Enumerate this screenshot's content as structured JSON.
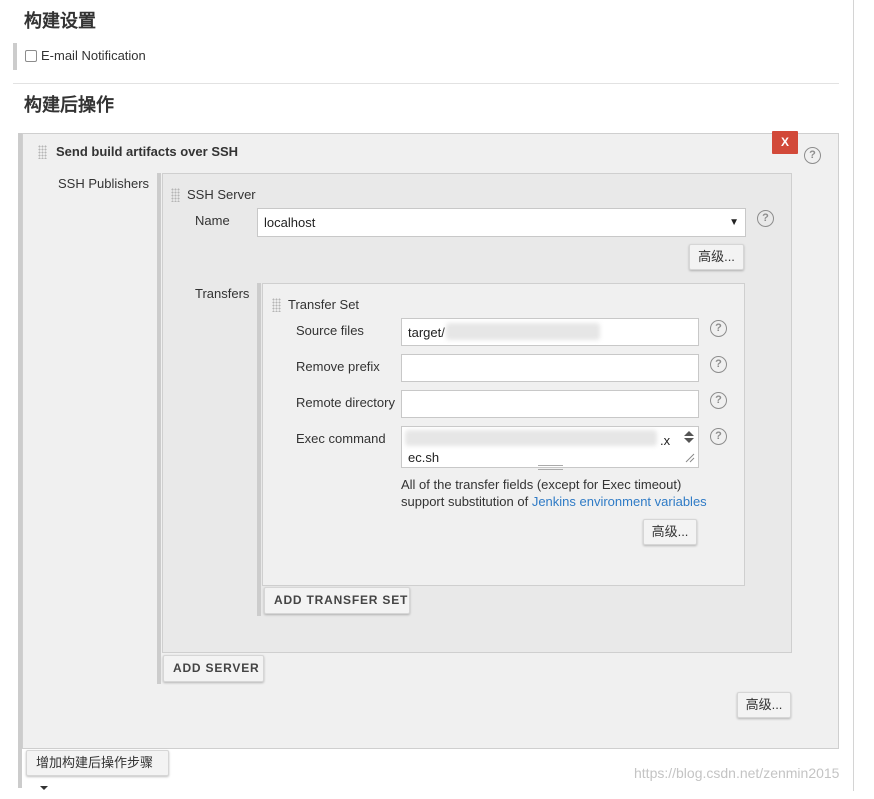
{
  "build_settings": {
    "title": "构建设置",
    "email_notification_label": "E-mail Notification",
    "email_notification_checked": false
  },
  "post_build": {
    "title": "构建后操作",
    "publisher": {
      "title": "Send build artifacts over SSH",
      "delete_label": "X",
      "ssh_publishers_label": "SSH Publishers",
      "ssh_server": {
        "title": "SSH Server",
        "name_label": "Name",
        "name_value": "localhost",
        "advanced_label": "高级...",
        "transfers_label": "Transfers",
        "transfer_set": {
          "title": "Transfer Set",
          "source_files_label": "Source files",
          "source_files_value": "target/",
          "remove_prefix_label": "Remove prefix",
          "remove_prefix_value": "",
          "remote_directory_label": "Remote directory",
          "remote_directory_value": "",
          "exec_command_label": "Exec command",
          "exec_command_line1_tail": ".x",
          "exec_command_line2": "ec.sh",
          "note_prefix": "All of the transfer fields (except for Exec timeout)",
          "note_middle": "support substitution of ",
          "note_link": "Jenkins environment variables",
          "advanced_label": "高级..."
        },
        "add_transfer_set_label": "ADD TRANSFER SET"
      },
      "add_server_label": "ADD SERVER",
      "advanced_label": "高级..."
    },
    "add_step_label": "增加构建后操作步骤"
  },
  "help_icon": "?",
  "dropdown_arrow": "▼",
  "watermark": "https://blog.csdn.net/zenmin2015",
  "colors": {
    "delete_button": "#d24939",
    "link": "#2f7bc6",
    "panel": "#f0f0f0",
    "inner_panel": "#e9e9e9"
  }
}
